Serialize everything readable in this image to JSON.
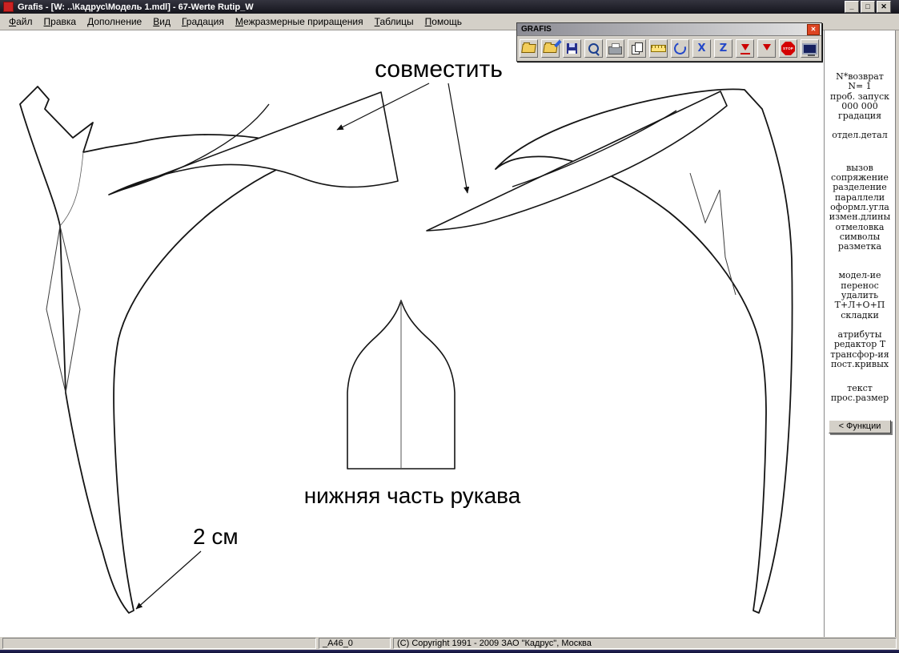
{
  "window": {
    "title": "Grafis - [W: ..\\Кадрус\\Модель 1.mdl] - 67-Werte Rutip_W",
    "controls": {
      "minimize": "_",
      "maximize": "□",
      "close": "✕"
    }
  },
  "menu": {
    "items": [
      "Файл",
      "Правка",
      "Дополнение",
      "Вид",
      "Градация",
      "Межразмерные приращения",
      "Таблицы",
      "Помощь"
    ]
  },
  "toolbox": {
    "title": "GRAFIS",
    "close_glyph": "✕",
    "icons": [
      "open-folder",
      "folder-import",
      "save",
      "zoom",
      "print",
      "copy-window",
      "ruler",
      "refresh",
      "zoom-x",
      "z-tool",
      "import-down",
      "download",
      "stop",
      "screen"
    ],
    "glyphs": {
      "zoom_x": "X",
      "z_tool": "Z",
      "stop": "STOP"
    }
  },
  "canvas": {
    "labels": {
      "align": "совместить",
      "lower_sleeve": "нижняя часть рукава",
      "measure": "2 см"
    }
  },
  "side_panel": {
    "groups": [
      [
        "N*возврат",
        "N=  1",
        "проб. запуск",
        "000 000",
        "градация"
      ],
      [
        "отдел.детал"
      ],
      [
        "вызов",
        "сопряжение",
        "разделение",
        "параллели",
        "оформл.угла",
        "измен.длины",
        "отмеловка",
        "символы",
        "разметка"
      ],
      [
        "модел-ие",
        "перенос",
        "удалить",
        "Т+Л+О+П",
        "складки"
      ],
      [
        "атрибуты",
        "редактор Т",
        "трансфор-ия",
        "пост.кривых"
      ],
      [
        "текст",
        "прос.размер"
      ]
    ],
    "functions_button": "< Функции"
  },
  "status": {
    "model_code": "_A46_0",
    "copyright": "(C) Copyright 1991 - 2009 ЗАО \"Кадрус\", Москва"
  }
}
